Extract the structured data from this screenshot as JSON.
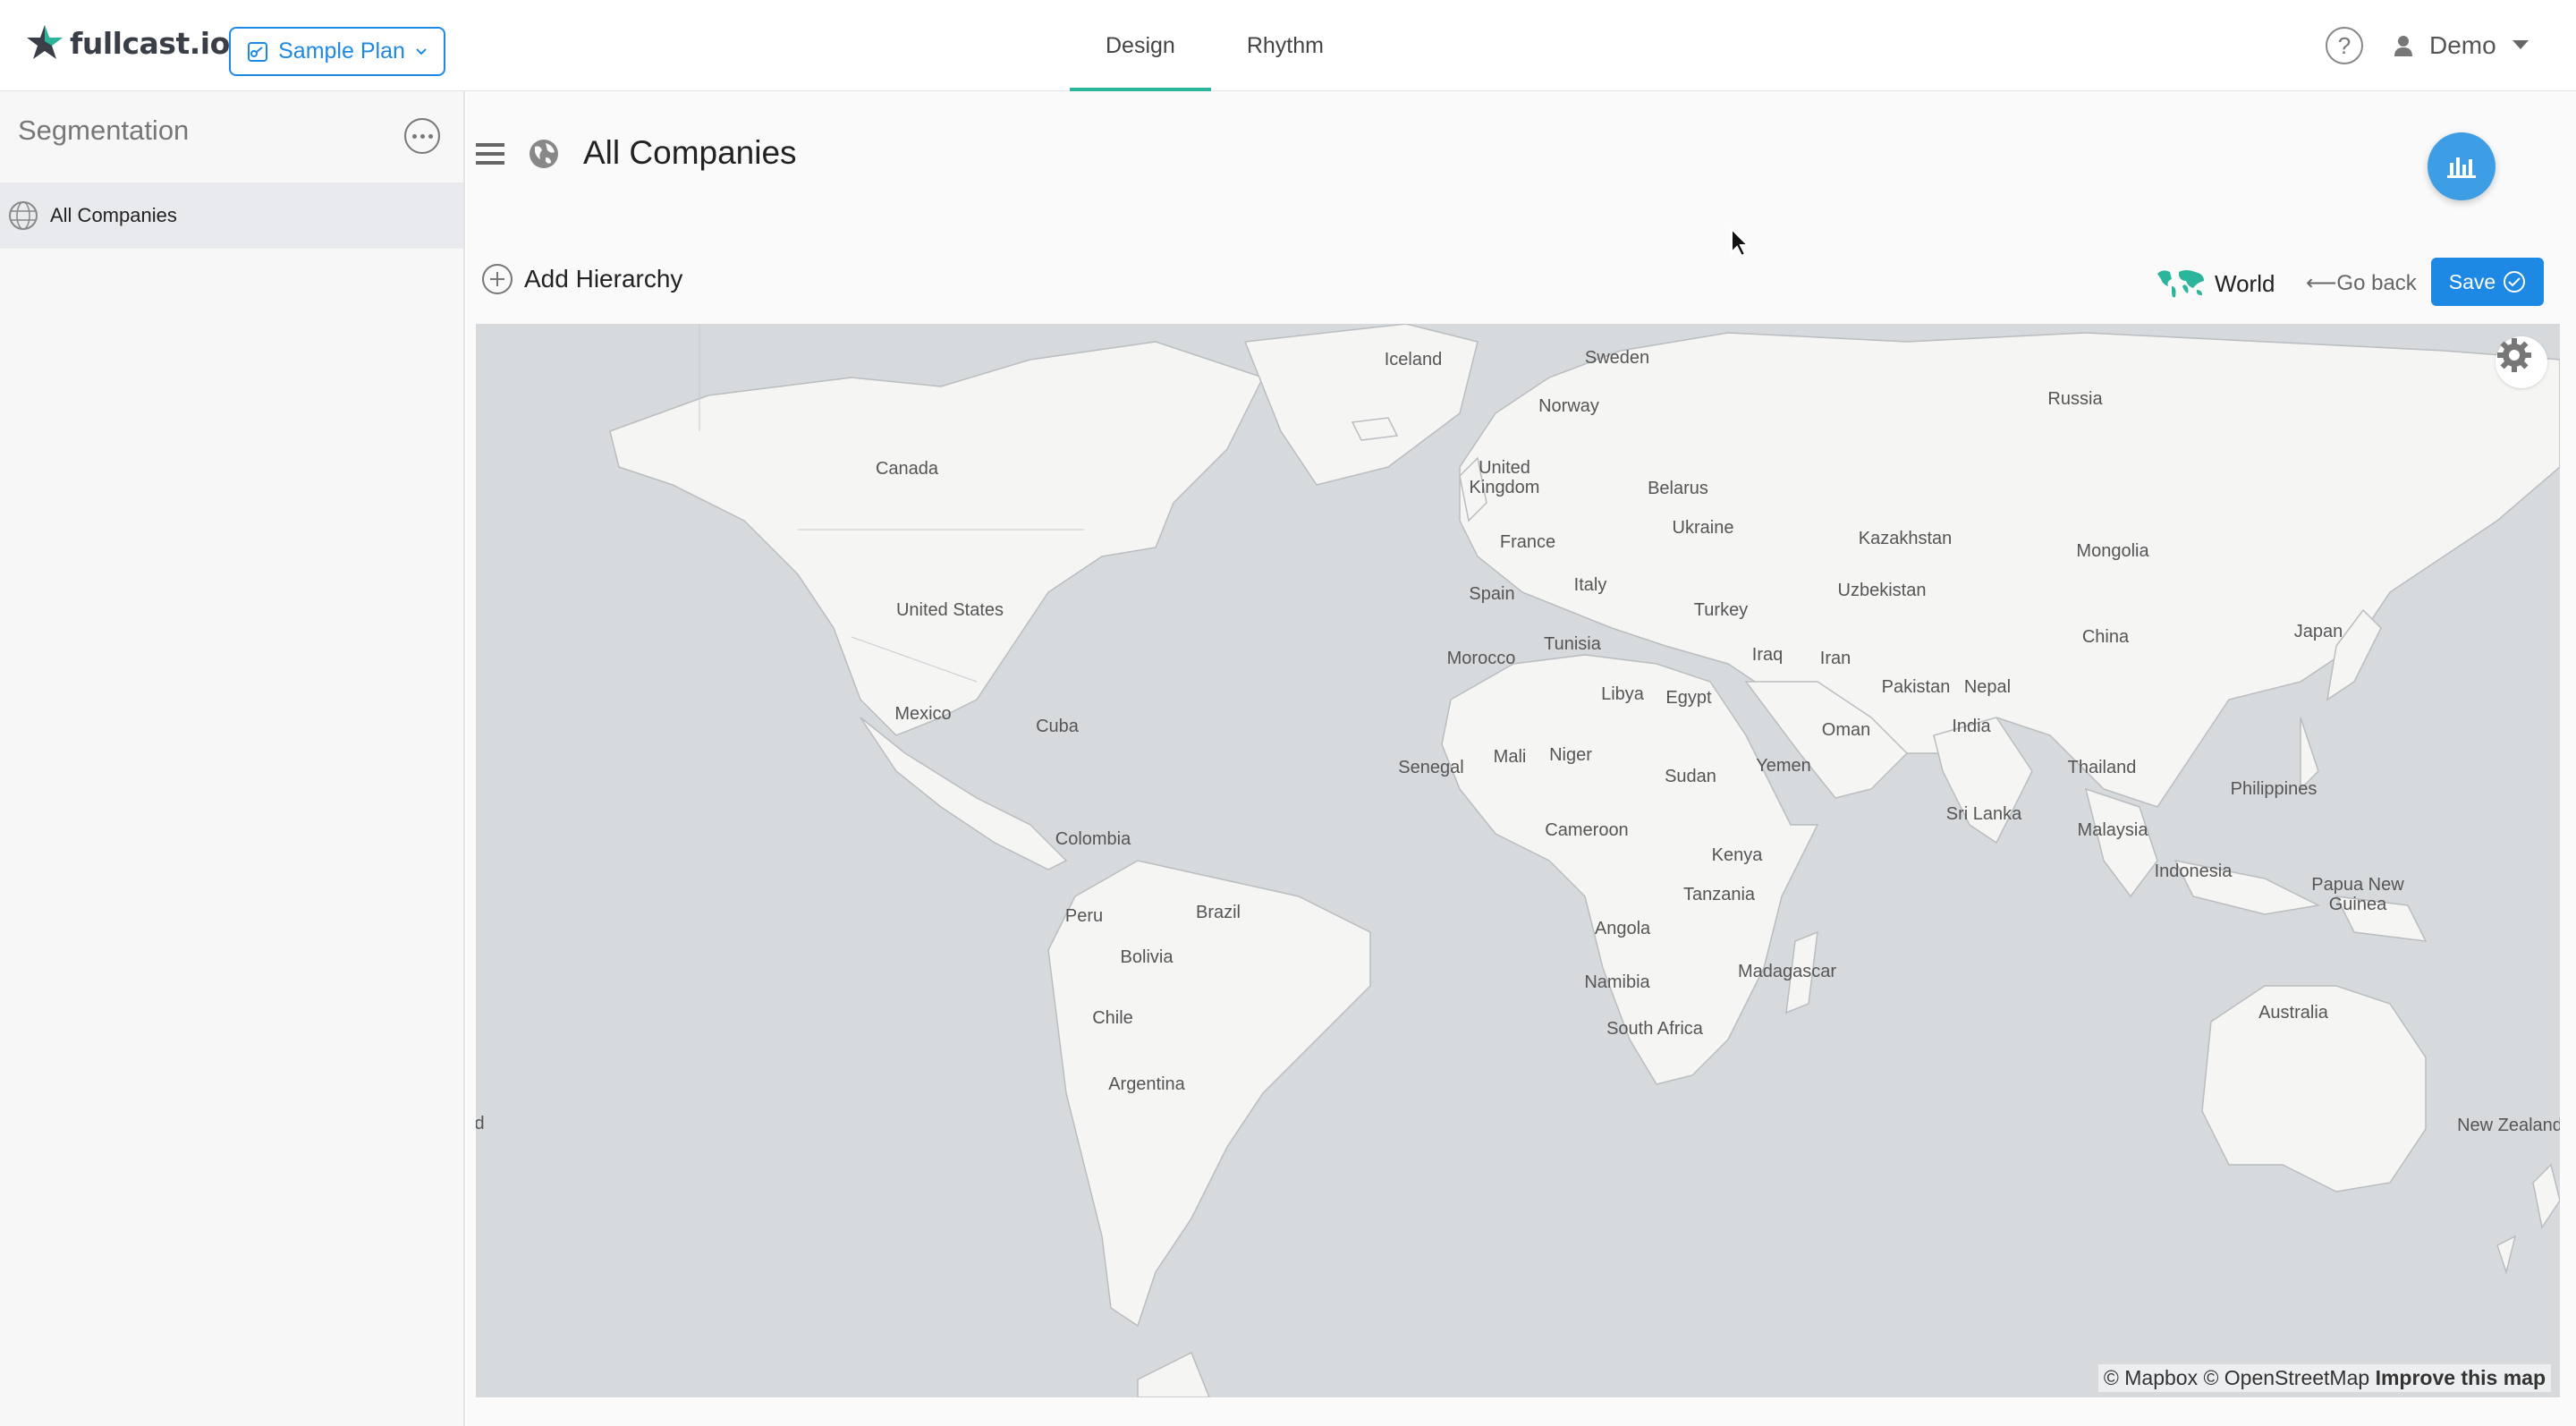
{
  "app": {
    "brand": "fullcast.io",
    "plan_label": "Sample Plan"
  },
  "tabs": [
    {
      "label": "Design",
      "active": true
    },
    {
      "label": "Rhythm",
      "active": false
    }
  ],
  "user": {
    "name": "Demo"
  },
  "sidebar": {
    "title": "Segmentation",
    "items": [
      {
        "label": "All Companies",
        "selected": true
      }
    ]
  },
  "main": {
    "title": "All Companies",
    "add_hierarchy": "Add Hierarchy",
    "world_label": "World",
    "go_back": "Go back",
    "save": "Save"
  },
  "map": {
    "attribution": "© Mapbox © OpenStreetMap",
    "improve": "Improve this map",
    "labels": [
      "Iceland",
      "Sweden",
      "Norway",
      "Russia",
      "Canada",
      "United\nKingdom",
      "Belarus",
      "Ukraine",
      "France",
      "Kazakhstan",
      "Mongolia",
      "United States",
      "Italy",
      "Spain",
      "Uzbekistan",
      "Turkey",
      "China",
      "Japan",
      "Tunisia",
      "Morocco",
      "Iraq",
      "Iran",
      "Pakistan",
      "Nepal",
      "Libya",
      "Egypt",
      "Mexico",
      "Cuba",
      "Oman",
      "India",
      "Senegal",
      "Mali",
      "Niger",
      "Sudan",
      "Yemen",
      "Thailand",
      "Philippines",
      "Sri Lanka",
      "Colombia",
      "Cameroon",
      "Malaysia",
      "Kenya",
      "Indonesia",
      "Papua New\nGuinea",
      "Tanzania",
      "Brazil",
      "Peru",
      "Angola",
      "Bolivia",
      "Madagascar",
      "Namibia",
      "Chile",
      "South Africa",
      "Australia",
      "Argentina",
      "New Zealand",
      "d"
    ]
  },
  "colors": {
    "accent": "#1e88e5",
    "tab_underline": "#2bb59a",
    "fab": "#3d9ee5",
    "ocean": "#d6dadd",
    "land": "#f5f5f4"
  }
}
